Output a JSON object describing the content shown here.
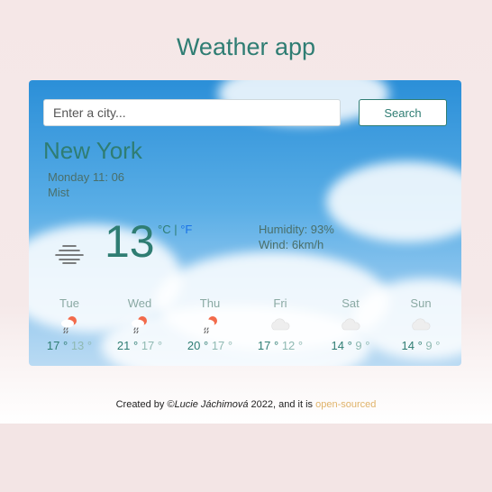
{
  "app": {
    "title": "Weather app"
  },
  "search": {
    "placeholder": "Enter a city...",
    "button_label": "Search"
  },
  "current": {
    "city": "New York",
    "datetime": "Monday 11: 06",
    "description": "Mist",
    "temperature": "13",
    "unit_celsius": "°C",
    "unit_separator": " | ",
    "unit_fahrenheit": "°F",
    "humidity": "Humidity: 93%",
    "wind": "Wind: 6km/h",
    "icon": "mist-icon"
  },
  "forecast": [
    {
      "day": "Tue",
      "max": "17 °",
      "min": "13 °",
      "icon": "rain-sun-icon"
    },
    {
      "day": "Wed",
      "max": "21 °",
      "min": "17 °",
      "icon": "rain-sun-icon"
    },
    {
      "day": "Thu",
      "max": "20 °",
      "min": "17 °",
      "icon": "rain-sun-icon"
    },
    {
      "day": "Fri",
      "max": "17 °",
      "min": "12 °",
      "icon": "cloud-icon"
    },
    {
      "day": "Sat",
      "max": "14 °",
      "min": "9 °",
      "icon": "cloud-icon"
    },
    {
      "day": "Sun",
      "max": "14 °",
      "min": "9 °",
      "icon": "cloud-icon"
    }
  ],
  "footer": {
    "prefix": "Created by ©",
    "author": "Lucie Jáchimová",
    "middle": " 2022, and it is ",
    "link_label": "open-sourced"
  },
  "colors": {
    "accent": "#2f7d73",
    "link": "#e0b36a",
    "fahrenheit": "#1a73e8"
  }
}
